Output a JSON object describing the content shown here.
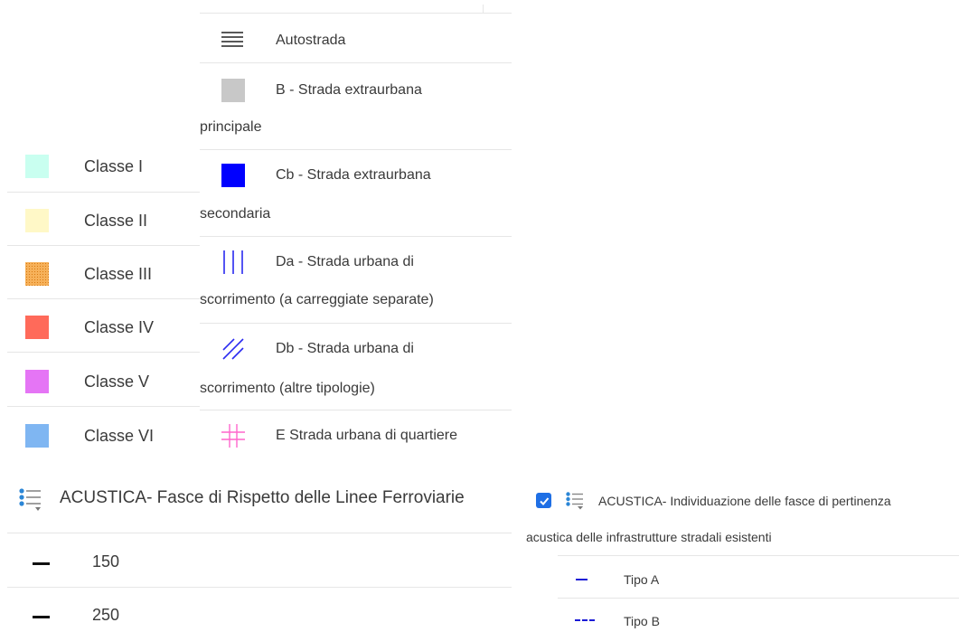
{
  "acoustic_classes": [
    {
      "label": "Classe I",
      "color": "#c9fff0"
    },
    {
      "label": "Classe II",
      "color": "#fff8c7"
    },
    {
      "label": "Classe III",
      "color": "#f29a3a"
    },
    {
      "label": "Classe IV",
      "color": "#ff6a5a"
    },
    {
      "label": "Classe V",
      "color": "#e575f5"
    },
    {
      "label": "Classe VI",
      "color": "#7fb6f2"
    }
  ],
  "road_types": [
    {
      "label_line1": "Autostrada",
      "label_line2": "",
      "icon": "horizontal-lines-icon",
      "color": "#222222"
    },
    {
      "label_line1": "B - Strada extraurbana",
      "label_line2": "principale",
      "icon": "gray-square-icon",
      "color": "#c8c8c8"
    },
    {
      "label_line1": "Cb - Strada extraurbana",
      "label_line2": "secondaria",
      "icon": "blue-square-icon",
      "color": "#0000ff"
    },
    {
      "label_line1": "Da - Strada urbana di",
      "label_line2": "scorrimento (a carreggiate separate)",
      "icon": "vertical-lines-icon",
      "color": "#2a2af0"
    },
    {
      "label_line1": "Db - Strada urbana di",
      "label_line2": "scorrimento (altre tipologie)",
      "icon": "diagonal-lines-icon",
      "color": "#2a2af0"
    },
    {
      "label_line1": "E Strada urbana di quartiere",
      "label_line2": "",
      "icon": "grid-hash-icon",
      "color": "#ff66cc"
    }
  ],
  "railway_layer": {
    "title": "ACUSTICA- Fasce di Rispetto delle Linee Ferroviarie",
    "items": [
      "150",
      "250"
    ]
  },
  "road_layer": {
    "checked": true,
    "title_line1": "ACUSTICA- Individuazione delle fasce di pertinenza",
    "title_line2": "acustica delle infrastrutture stradali esistenti",
    "items": [
      {
        "label": "Tipo A",
        "style": "solid"
      },
      {
        "label": "Tipo B",
        "style": "dashed"
      }
    ]
  }
}
